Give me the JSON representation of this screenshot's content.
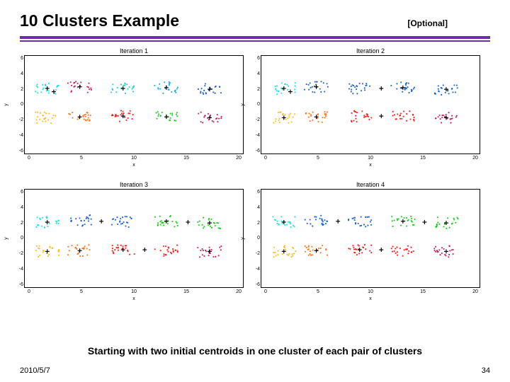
{
  "header": {
    "title": "10 Clusters Example",
    "optional": "[Optional]"
  },
  "caption": "Starting with two initial centroids in one cluster of each pair of clusters",
  "footer": {
    "date": "2010/5/7",
    "page": "34"
  },
  "chart_data": [
    {
      "type": "scatter",
      "title": "Iteration 1",
      "xlabel": "x",
      "ylabel": "y",
      "xlim": [
        0,
        20
      ],
      "ylim": [
        -6,
        6
      ],
      "xticks": [
        0,
        5,
        10,
        15,
        20
      ],
      "yticks": [
        6,
        4,
        2,
        0,
        -2,
        -4,
        -6
      ],
      "clusters": [
        {
          "cx": 2,
          "cy": 2,
          "color": "#00e0e0"
        },
        {
          "cx": 5,
          "cy": 2.2,
          "color": "#c80050"
        },
        {
          "cx": 9,
          "cy": 2,
          "color": "#00c8c8"
        },
        {
          "cx": 13,
          "cy": 2.1,
          "color": "#00a0ff"
        },
        {
          "cx": 17,
          "cy": 1.9,
          "color": "#0050c8"
        },
        {
          "cx": 2,
          "cy": -1.6,
          "color": "#ffb400"
        },
        {
          "cx": 5,
          "cy": -1.5,
          "color": "#ff6400"
        },
        {
          "cx": 9,
          "cy": -1.4,
          "color": "#ff0000"
        },
        {
          "cx": 13,
          "cy": -1.5,
          "color": "#00c800"
        },
        {
          "cx": 17,
          "cy": -1.6,
          "color": "#c80050"
        }
      ],
      "centroids": [
        {
          "x": 2,
          "y": 2
        },
        {
          "x": 2.6,
          "y": 1.6
        },
        {
          "x": 5,
          "y": 2.2
        },
        {
          "x": 9,
          "y": 2
        },
        {
          "x": 13,
          "y": 2.1
        },
        {
          "x": 17,
          "y": 1.9
        },
        {
          "x": 5,
          "y": -1.5
        },
        {
          "x": 9,
          "y": -1.4
        },
        {
          "x": 13,
          "y": -1.5
        },
        {
          "x": 17,
          "y": -1.6
        }
      ]
    },
    {
      "type": "scatter",
      "title": "Iteration 2",
      "xlabel": "x",
      "ylabel": "y",
      "xlim": [
        0,
        20
      ],
      "ylim": [
        -6,
        6
      ],
      "xticks": [
        0,
        5,
        10,
        15,
        20
      ],
      "yticks": [
        6,
        4,
        2,
        0,
        -2,
        -4,
        -6
      ],
      "clusters": [
        {
          "cx": 2,
          "cy": 2,
          "color": "#00e0e0"
        },
        {
          "cx": 5,
          "cy": 2.2,
          "color": "#0050c8"
        },
        {
          "cx": 9,
          "cy": 2,
          "color": "#0050c8"
        },
        {
          "cx": 13,
          "cy": 2.1,
          "color": "#0050c8"
        },
        {
          "cx": 17,
          "cy": 1.9,
          "color": "#0050c8"
        },
        {
          "cx": 2,
          "cy": -1.6,
          "color": "#ffb400"
        },
        {
          "cx": 5,
          "cy": -1.5,
          "color": "#ff6400"
        },
        {
          "cx": 9,
          "cy": -1.4,
          "color": "#ff0000"
        },
        {
          "cx": 13,
          "cy": -1.5,
          "color": "#ff0000"
        },
        {
          "cx": 17,
          "cy": -1.6,
          "color": "#c80050"
        }
      ],
      "centroids": [
        {
          "x": 2,
          "y": 2
        },
        {
          "x": 2.6,
          "y": 1.6
        },
        {
          "x": 11,
          "y": 2
        },
        {
          "x": 2,
          "y": -1.6
        },
        {
          "x": 5,
          "y": -1.5
        },
        {
          "x": 11,
          "y": -1.4
        },
        {
          "x": 17,
          "y": -1.6
        },
        {
          "x": 13,
          "y": 2.1
        },
        {
          "x": 17,
          "y": 1.9
        },
        {
          "x": 5,
          "y": 2.2
        }
      ]
    },
    {
      "type": "scatter",
      "title": "Iteration 3",
      "xlabel": "x",
      "ylabel": "y",
      "xlim": [
        0,
        20
      ],
      "ylim": [
        -6,
        6
      ],
      "xticks": [
        0,
        5,
        10,
        15,
        20
      ],
      "yticks": [
        6,
        4,
        2,
        0,
        -2,
        -4,
        -6
      ],
      "clusters": [
        {
          "cx": 2,
          "cy": 2,
          "color": "#00e0e0"
        },
        {
          "cx": 5,
          "cy": 2.2,
          "color": "#0050c8"
        },
        {
          "cx": 9,
          "cy": 2,
          "color": "#0050c8"
        },
        {
          "cx": 13,
          "cy": 2.1,
          "color": "#00c800"
        },
        {
          "cx": 17,
          "cy": 1.9,
          "color": "#00c800"
        },
        {
          "cx": 2,
          "cy": -1.6,
          "color": "#ffb400"
        },
        {
          "cx": 5,
          "cy": -1.5,
          "color": "#ff6400"
        },
        {
          "cx": 9,
          "cy": -1.4,
          "color": "#ff0000"
        },
        {
          "cx": 13,
          "cy": -1.5,
          "color": "#ff0000"
        },
        {
          "cx": 17,
          "cy": -1.6,
          "color": "#c80050"
        }
      ],
      "centroids": [
        {
          "x": 2,
          "y": 2
        },
        {
          "x": 7,
          "y": 2.1
        },
        {
          "x": 15,
          "y": 2
        },
        {
          "x": 2,
          "y": -1.6
        },
        {
          "x": 5,
          "y": -1.5
        },
        {
          "x": 11,
          "y": -1.4
        },
        {
          "x": 17,
          "y": -1.6
        },
        {
          "x": 13,
          "y": 2.1
        },
        {
          "x": 17,
          "y": 1.9
        },
        {
          "x": 9,
          "y": -1.4
        }
      ]
    },
    {
      "type": "scatter",
      "title": "Iteration 4",
      "xlabel": "x",
      "ylabel": "y",
      "xlim": [
        0,
        20
      ],
      "ylim": [
        -6,
        6
      ],
      "xticks": [
        0,
        5,
        10,
        15,
        20
      ],
      "yticks": [
        6,
        4,
        2,
        0,
        -2,
        -4,
        -6
      ],
      "clusters": [
        {
          "cx": 2,
          "cy": 2,
          "color": "#00e0e0"
        },
        {
          "cx": 5,
          "cy": 2.2,
          "color": "#0050c8"
        },
        {
          "cx": 9,
          "cy": 2,
          "color": "#0050c8"
        },
        {
          "cx": 13,
          "cy": 2.1,
          "color": "#00c800"
        },
        {
          "cx": 17,
          "cy": 1.9,
          "color": "#00c800"
        },
        {
          "cx": 2,
          "cy": -1.6,
          "color": "#ffb400"
        },
        {
          "cx": 5,
          "cy": -1.5,
          "color": "#ff6400"
        },
        {
          "cx": 9,
          "cy": -1.4,
          "color": "#ff0000"
        },
        {
          "cx": 13,
          "cy": -1.5,
          "color": "#ff0000"
        },
        {
          "cx": 17,
          "cy": -1.6,
          "color": "#c80050"
        }
      ],
      "centroids": [
        {
          "x": 2,
          "y": 2
        },
        {
          "x": 7,
          "y": 2.1
        },
        {
          "x": 15,
          "y": 2
        },
        {
          "x": 2,
          "y": -1.6
        },
        {
          "x": 5,
          "y": -1.5
        },
        {
          "x": 11,
          "y": -1.4
        },
        {
          "x": 17,
          "y": -1.6
        },
        {
          "x": 13,
          "y": 2.1
        },
        {
          "x": 17,
          "y": 1.9
        },
        {
          "x": 9,
          "y": -1.4
        }
      ]
    }
  ]
}
